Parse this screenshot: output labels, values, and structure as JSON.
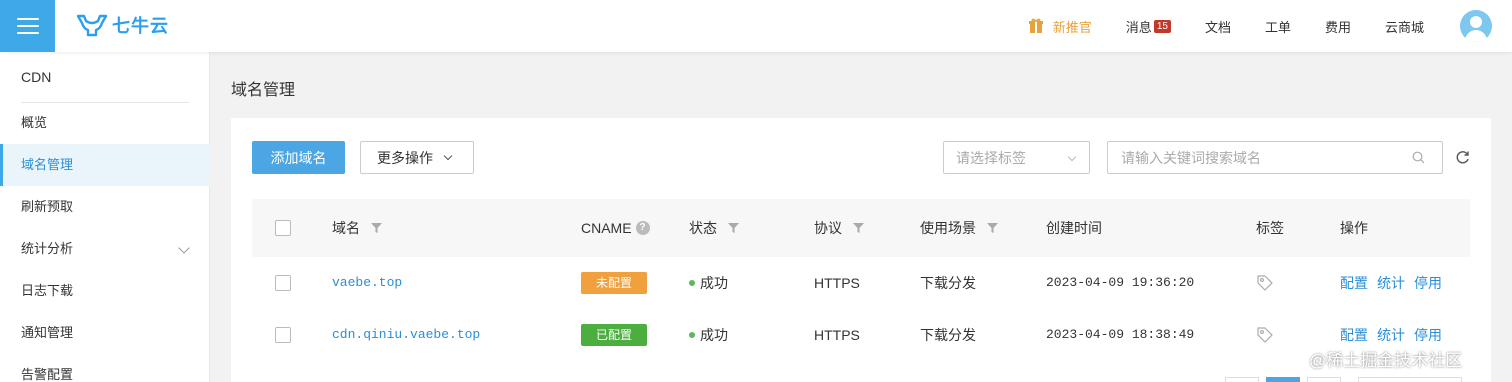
{
  "header": {
    "logo_text": "七牛云",
    "nav": [
      {
        "label": "新推官",
        "icon": "gift-icon"
      },
      {
        "label": "消息",
        "badge": "15"
      },
      {
        "label": "文档"
      },
      {
        "label": "工单"
      },
      {
        "label": "费用"
      },
      {
        "label": "云商城"
      }
    ]
  },
  "sidebar": {
    "title": "CDN",
    "items": [
      {
        "label": "概览"
      },
      {
        "label": "域名管理",
        "active": true
      },
      {
        "label": "刷新预取"
      },
      {
        "label": "统计分析",
        "expandable": true
      },
      {
        "label": "日志下载"
      },
      {
        "label": "通知管理"
      },
      {
        "label": "告警配置"
      }
    ]
  },
  "main": {
    "page_title": "域名管理",
    "toolbar": {
      "add_label": "添加域名",
      "more_label": "更多操作",
      "tag_placeholder": "请选择标签",
      "search_placeholder": "请输入关键词搜索域名"
    },
    "table": {
      "columns": [
        "域名",
        "CNAME",
        "状态",
        "协议",
        "使用场景",
        "创建时间",
        "标签",
        "操作"
      ],
      "rows": [
        {
          "domain": "vaebe.top",
          "cname": "未配置",
          "status": "成功",
          "protocol": "HTTPS",
          "scene": "下载分发",
          "created": "2023-04-09 19:36:20",
          "ops": [
            "配置",
            "统计",
            "停用"
          ]
        },
        {
          "domain": "cdn.qiniu.vaebe.top",
          "cname": "已配置",
          "status": "成功",
          "protocol": "HTTPS",
          "scene": "下载分发",
          "created": "2023-04-09 18:38:49",
          "ops": [
            "配置",
            "统计",
            "停用"
          ]
        }
      ]
    }
  },
  "colors": {
    "accent": "#3fa8e6",
    "link": "#2a8fd7",
    "cname_unconfigured": "#f0a03c",
    "cname_configured": "#4cae3f",
    "status_ok": "#5cb85c"
  },
  "watermark": "@稀土掘金技术社区"
}
